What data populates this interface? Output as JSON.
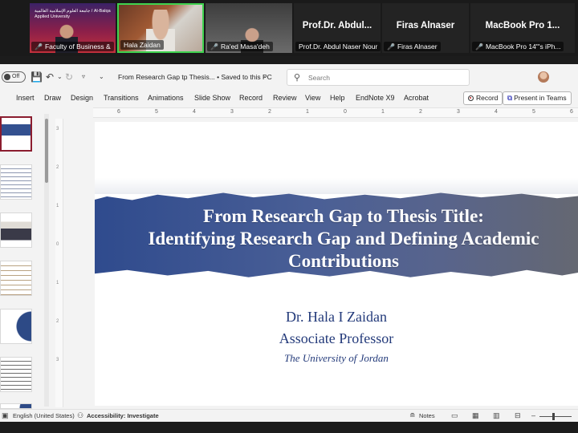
{
  "zoom": {
    "tiles": [
      {
        "banner_text": "جامعة العلوم الإسلامية العالمية / Al-Balqa Applied University",
        "label": "Faculty of Business &",
        "muted": true
      },
      {
        "label": "Hala Zaidan",
        "muted": false
      },
      {
        "label": "Ra'ed Masa'deh",
        "muted": true
      },
      {
        "big_name": "Prof.Dr. Abdul...",
        "label": "Prof.Dr. Abdul Naser Nour",
        "muted": false
      },
      {
        "big_name": "Firas Alnaser",
        "label": "Firas Alnaser",
        "muted": true
      },
      {
        "big_name": "MacBook Pro 1...",
        "label": "MacBook Pro 14\"'s iPh...",
        "muted": true
      }
    ]
  },
  "titlebar": {
    "autosave_label": "Off",
    "document_title": "From Research Gap tp Thesis... • Saved to this PC",
    "search_placeholder": "Search"
  },
  "ribbon": {
    "tabs": [
      "Insert",
      "Draw",
      "Design",
      "Transitions",
      "Animations",
      "Slide Show",
      "Record",
      "Review",
      "View",
      "Help",
      "EndNote X9",
      "Acrobat"
    ],
    "record_button": "Record",
    "present_teams_button": "Present in Teams"
  },
  "ruler": {
    "ticks": [
      "6",
      "5",
      "4",
      "3",
      "2",
      "1",
      "0",
      "1",
      "2",
      "3",
      "4",
      "5",
      "6"
    ],
    "vticks": [
      "3",
      "2",
      "1",
      "0",
      "1",
      "2",
      "3"
    ]
  },
  "slide": {
    "title_line1": "From Research Gap to Thesis Title:",
    "title_line2": "Identifying Research Gap and Defining Academic",
    "title_line3": "Contributions",
    "author_name": "Dr. Hala I Zaidan",
    "author_role": "Associate Professor",
    "author_university": "The University of Jordan"
  },
  "statusbar": {
    "language": "English (United States)",
    "accessibility_label": "Accessibility: Investigate",
    "notes_label": "Notes"
  },
  "colors": {
    "accent_ppt": "#b0356b",
    "active_speaker": "#3fd34f",
    "slide_blue": "#2e4a8d",
    "slide_text": "#233a7a"
  }
}
